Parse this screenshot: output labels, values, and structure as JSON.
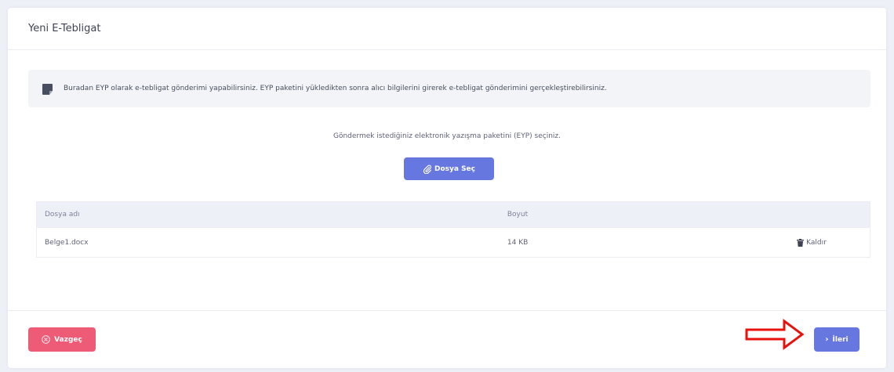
{
  "card": {
    "title": "Yeni E-Tebligat"
  },
  "info": {
    "text": "Buradan EYP olarak e-tebligat gönderimi yapabilirsiniz. EYP paketini yükledikten sonra alıcı bilgilerini girerek e-tebligat gönderimini gerçekleştirebilirsiniz.",
    "icon": "note-icon"
  },
  "upload": {
    "hint": "Göndermek istediğiniz elektronik yazışma paketini (EYP) seçiniz.",
    "button_label": "Dosya Seç",
    "button_icon": "paperclip-icon"
  },
  "file_table": {
    "headers": {
      "name": "Dosya adı",
      "size": "Boyut"
    },
    "rows": [
      {
        "name": "Belge1.docx",
        "size": "14 KB",
        "action_label": "Kaldır"
      }
    ]
  },
  "footer": {
    "cancel_label": "Vazgeç",
    "next_label": "İleri"
  },
  "colors": {
    "primary": "#6777e0",
    "danger": "#ee5b76",
    "annotation_red": "#e8120c"
  }
}
